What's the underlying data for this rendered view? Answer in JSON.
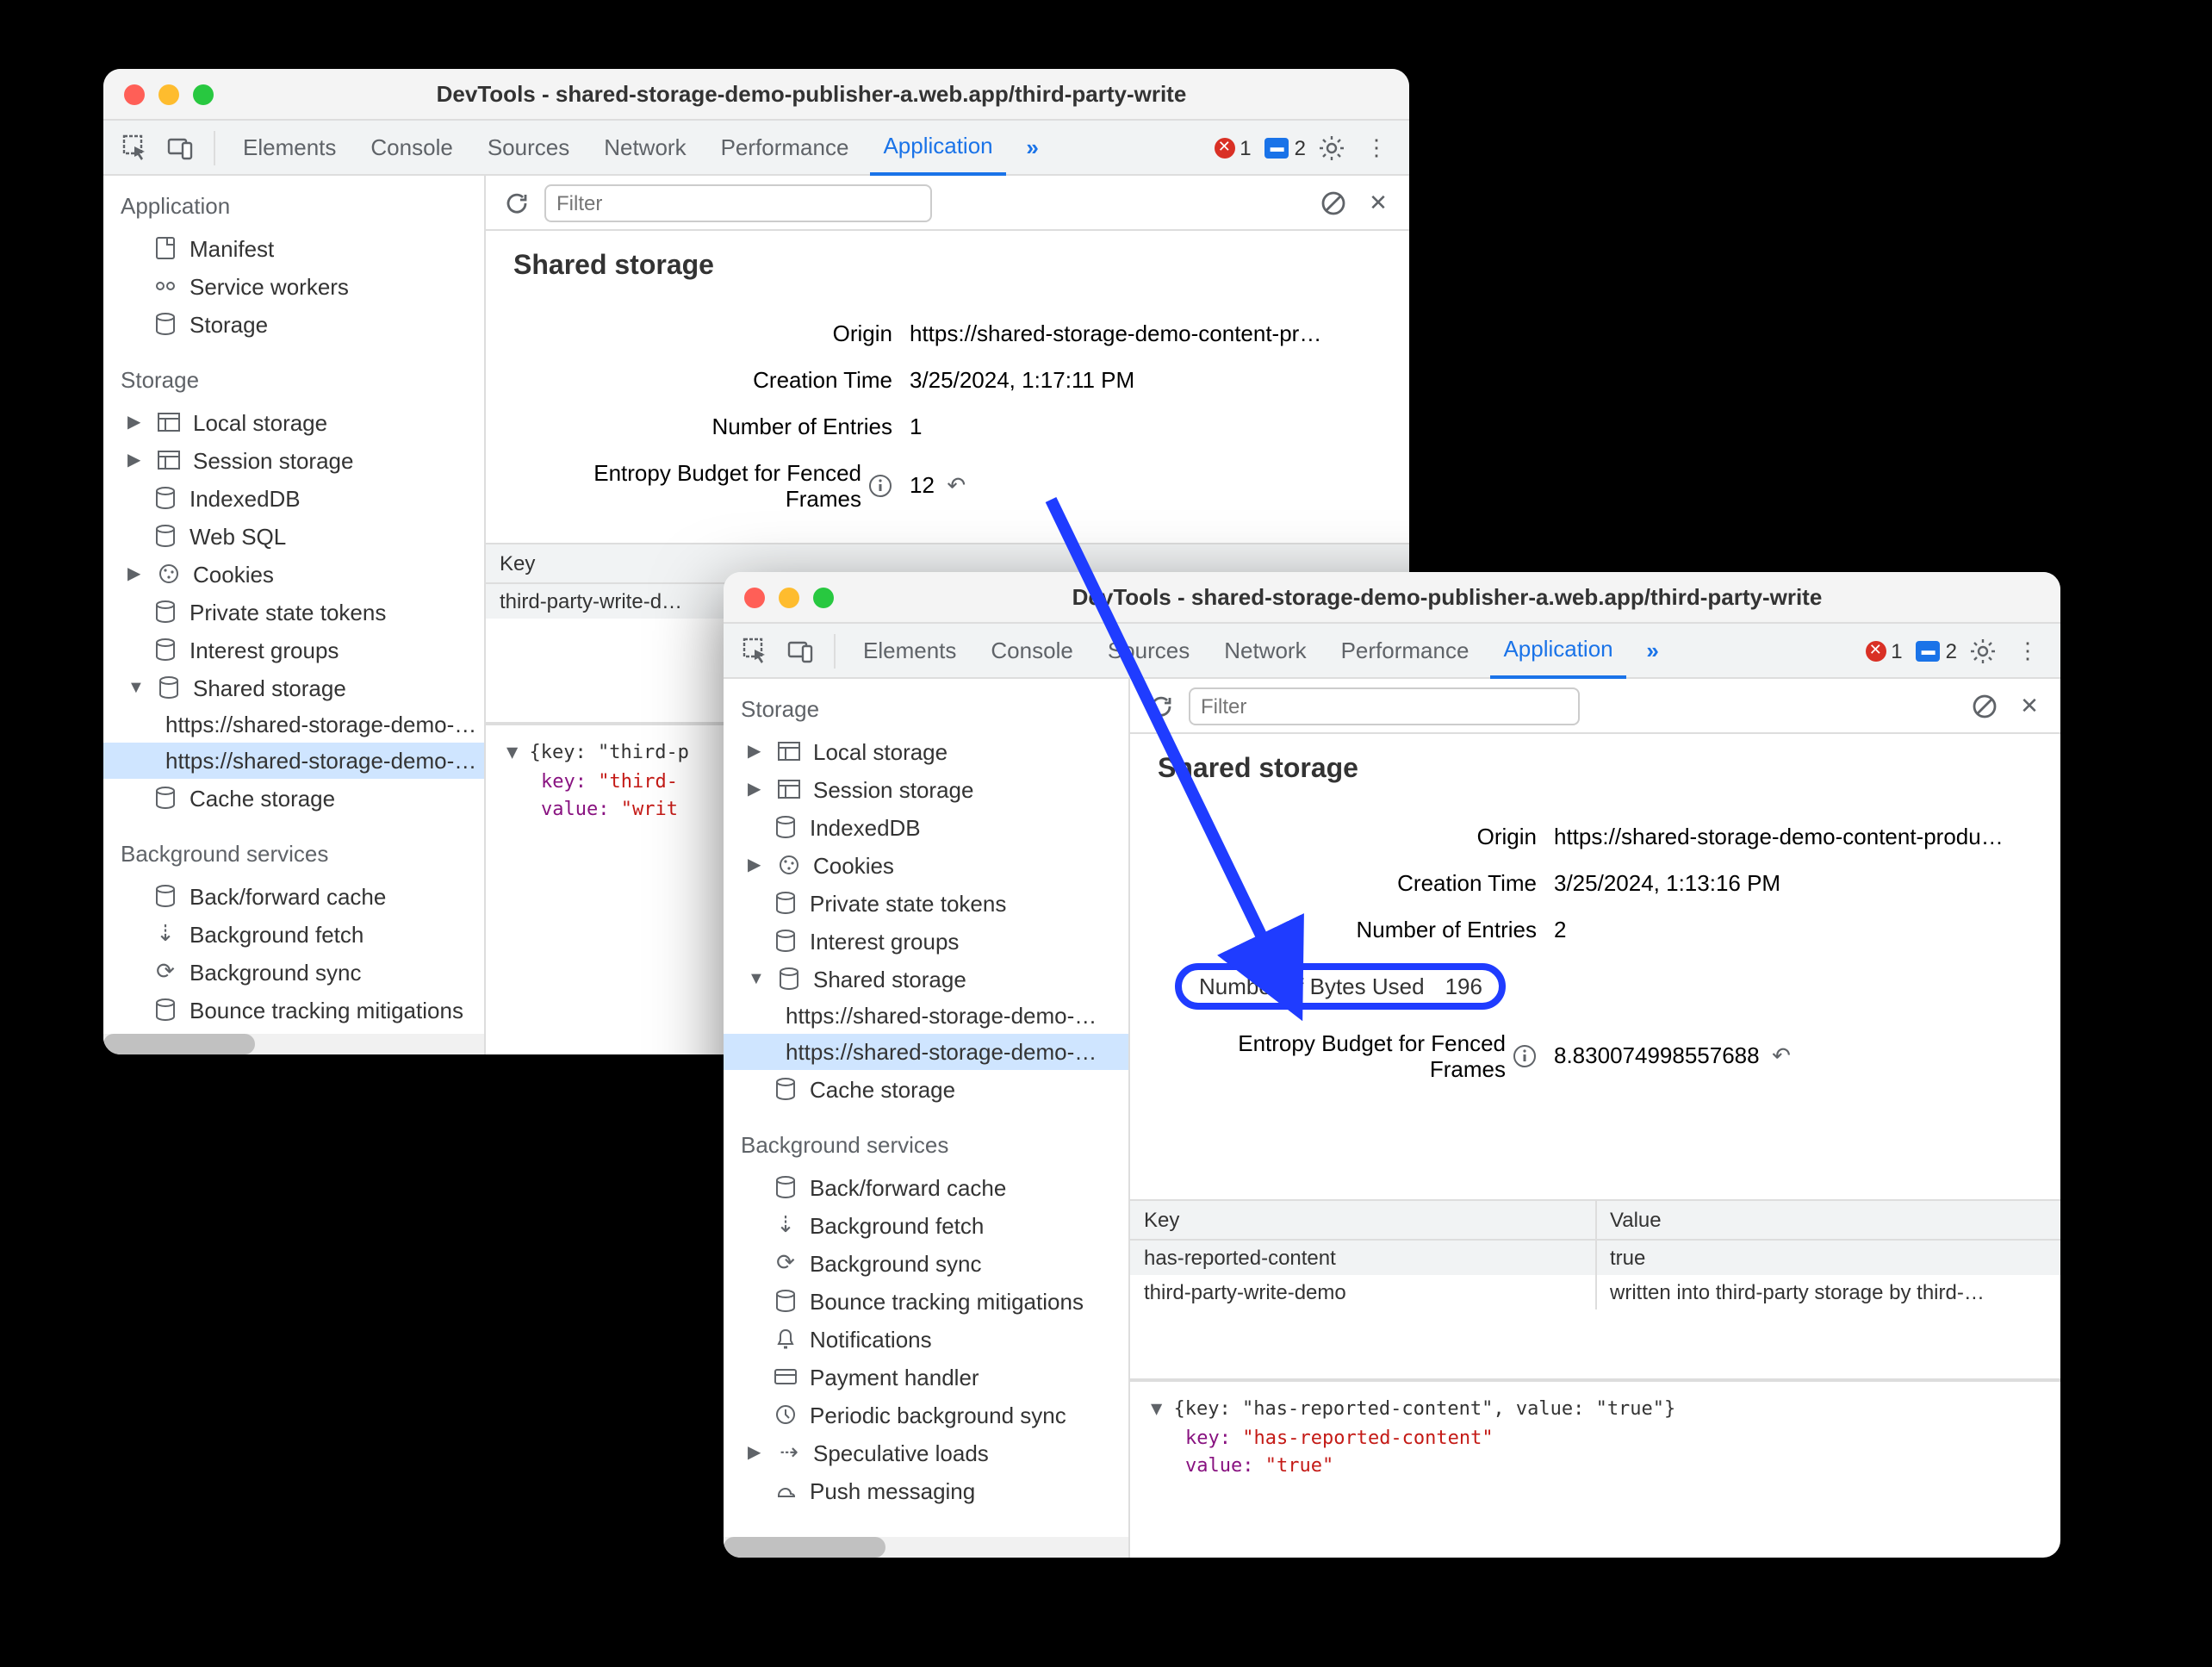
{
  "window_a": {
    "title": "DevTools - shared-storage-demo-publisher-a.web.app/third-party-write",
    "tabs": [
      "Elements",
      "Console",
      "Sources",
      "Network",
      "Performance",
      "Application"
    ],
    "active_tab": "Application",
    "errors": "1",
    "messages": "2",
    "filter_placeholder": "Filter",
    "heading": "Shared storage",
    "props": {
      "origin_label": "Origin",
      "origin_value": "https://shared-storage-demo-content-pr…",
      "creation_label": "Creation Time",
      "creation_value": "3/25/2024, 1:17:11 PM",
      "entries_label": "Number of Entries",
      "entries_value": "1",
      "budget_label": "Entropy Budget for Fenced Frames",
      "budget_value": "12"
    },
    "sidebar": {
      "app_title": "Application",
      "app_items": [
        "Manifest",
        "Service workers",
        "Storage"
      ],
      "storage_title": "Storage",
      "storage_items": [
        {
          "label": "Local storage",
          "expand": "▶"
        },
        {
          "label": "Session storage",
          "expand": "▶"
        },
        {
          "label": "IndexedDB"
        },
        {
          "label": "Web SQL"
        },
        {
          "label": "Cookies",
          "expand": "▶"
        },
        {
          "label": "Private state tokens"
        },
        {
          "label": "Interest groups"
        },
        {
          "label": "Shared storage",
          "expand": "▼",
          "children": [
            "https://shared-storage-demo-…",
            "https://shared-storage-demo-…"
          ]
        },
        {
          "label": "Cache storage"
        }
      ],
      "bg_title": "Background services",
      "bg_items": [
        "Back/forward cache",
        "Background fetch",
        "Background sync",
        "Bounce tracking mitigations"
      ]
    },
    "table": {
      "col_key": "Key",
      "row0_key": "third-party-write-d…"
    },
    "console": {
      "line1": "▼ {key: \"third-p",
      "line2": "key: ",
      "val2": "\"third-",
      "line3": "value: ",
      "val3": "\"writ"
    }
  },
  "window_b": {
    "title": "DevTools - shared-storage-demo-publisher-a.web.app/third-party-write",
    "tabs": [
      "Elements",
      "Console",
      "Sources",
      "Network",
      "Performance",
      "Application"
    ],
    "active_tab": "Application",
    "errors": "1",
    "messages": "2",
    "filter_placeholder": "Filter",
    "heading": "Shared storage",
    "props": {
      "origin_label": "Origin",
      "origin_value": "https://shared-storage-demo-content-produ…",
      "creation_label": "Creation Time",
      "creation_value": "3/25/2024, 1:13:16 PM",
      "entries_label": "Number of Entries",
      "entries_value": "2",
      "bytes_label": "Number of Bytes Used",
      "bytes_value": "196",
      "budget_label": "Entropy Budget for Fenced Frames",
      "budget_value": "8.830074998557688"
    },
    "sidebar": {
      "storage_title": "Storage",
      "storage_items": [
        {
          "label": "Local storage",
          "expand": "▶"
        },
        {
          "label": "Session storage",
          "expand": "▶"
        },
        {
          "label": "IndexedDB"
        },
        {
          "label": "Cookies",
          "expand": "▶"
        },
        {
          "label": "Private state tokens"
        },
        {
          "label": "Interest groups"
        },
        {
          "label": "Shared storage",
          "expand": "▼",
          "children": [
            "https://shared-storage-demo-…",
            "https://shared-storage-demo-…"
          ]
        },
        {
          "label": "Cache storage"
        }
      ],
      "bg_title": "Background services",
      "bg_items": [
        "Back/forward cache",
        "Background fetch",
        "Background sync",
        "Bounce tracking mitigations",
        "Notifications",
        "Payment handler",
        "Periodic background sync",
        "Speculative loads",
        "Push messaging"
      ]
    },
    "table": {
      "col_key": "Key",
      "col_value": "Value",
      "rows": [
        {
          "k": "has-reported-content",
          "v": "true"
        },
        {
          "k": "third-party-write-demo",
          "v": "written into third-party storage by third-…"
        }
      ]
    },
    "console": {
      "line1": "▼ {key: \"has-reported-content\", value: \"true\"}",
      "key_label": "key: ",
      "key_val": "\"has-reported-content\"",
      "val_label": "value: ",
      "val_val": "\"true\""
    }
  }
}
